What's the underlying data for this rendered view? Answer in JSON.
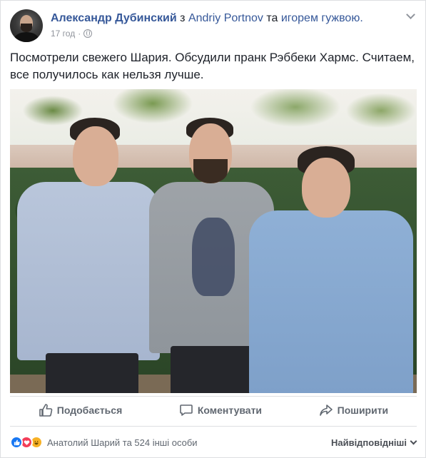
{
  "post": {
    "author": "Александр Дубинский",
    "tag_connector_1": "з",
    "tagged_user": "Andriy Portnov",
    "tag_connector_2": "та",
    "tagged_other": "игорем гужвою.",
    "time": "17 год",
    "separator": "·",
    "text": "Посмотрели свежего Шария. Обсудили пранк Рэббеки Хармс. Считаем, все получилось как нельзя лучше."
  },
  "actions": {
    "like_label": "Подобається",
    "comment_label": "Коментувати",
    "share_label": "Поширити"
  },
  "reactions": {
    "summary": "Анатолий Шарий та 524 інші особи",
    "sort_label": "Найвідповідніші"
  },
  "colors": {
    "link": "#365899",
    "meta": "#90949c",
    "action": "#606770",
    "like": "#1877f2",
    "love": "#f33e58",
    "haha": "#f7b125"
  }
}
